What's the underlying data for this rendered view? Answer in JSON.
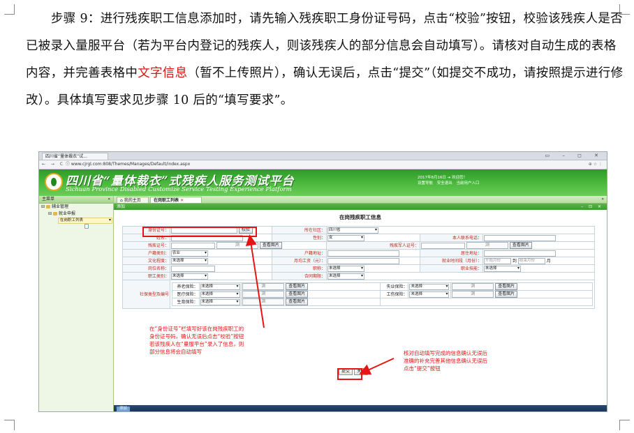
{
  "doc": {
    "p1_a": "步骤 9：进行残疾职工信息添加时，请先输入残疾职工身份证号码，点击“校验”按钮，校验该残疾人是否已被录入量服平台（若为平台内登记的残疾人，则该残疾人的部分信息会自动填写）。请核对自动生成的表格内容，并完善表格中",
    "p1_red": "文字信息",
    "p1_b": "（暂不上传照片），确认无误后，点击“提交”（如提交不成功，请按照提示进行修改）。具体填写要求见步骤 10 后的“填写要求”。"
  },
  "browser": {
    "tab_title": "四川省“量体裁衣”试...",
    "window_controls": "▭ – ◻ ✕",
    "nav": "← → C",
    "url": "ⓘ www.cjrgl.com:808/Themes/Manages/Default/index.aspx",
    "right_icons": "⊕ ☆ ⋮"
  },
  "banner": {
    "title_cn": "四川省“量体裁衣”式残疾人服务测试平台",
    "title_en": "Sichuan Province Disabled Customize Service Testing Experience Platform",
    "date": "2017年8月16日",
    "welcome": "欢迎您！",
    "links": [
      "设置导航",
      "安全退出",
      "当前用户入口"
    ]
  },
  "sidebar": {
    "header": "主菜单",
    "collapse": "«",
    "items": [
      "辅业管理",
      "就业申报",
      "在岗职工列表"
    ]
  },
  "content_tabs": [
    {
      "label": "我的主页"
    },
    {
      "label": "在岗职工列表"
    }
  ],
  "tab_close": "✕",
  "tab_more": "»",
  "panel": {
    "title": "添加",
    "controls": "– ⊡ ✕"
  },
  "form": {
    "title": "在岗残疾职工信息",
    "id_label": "身份证号：",
    "verify_button": "校验",
    "community_label": "所在社区：",
    "community_value": "四川省",
    "name_label": "姓名：",
    "gender_label": "性别：",
    "gender_value": "女",
    "phone_label": "本人联系电话：",
    "disability_cert_label": "残疾证号：",
    "view_image": "查看图片",
    "guardian_cert_label": "残疾军人证号：",
    "household_type_label": "户籍类别：",
    "household_type_value": "农业",
    "household_addr_label": "户籍地址：",
    "residence_label": "居住地址：",
    "education_label": "文化程度：",
    "unselected": "未选择",
    "monthly_wage_label": "月均工资（元）：",
    "employment_time_label": "就业时间段（月份）：",
    "start_month": "开始月份",
    "to": "到",
    "end_month": "结束月份",
    "month": "月",
    "position_label": "岗位名称：",
    "title_label": "职称：",
    "vocation_label": "职业技能：",
    "job_category_label": "职工类别：",
    "contract_label": "合同期限：",
    "insurance_label": "社保类型及编号",
    "pension": "养老保险：",
    "unemployment": "失业保险：",
    "medical": "医疗保险：",
    "injury": "工伤保险：",
    "maternity": "生育保险：",
    "submit_button": "提交",
    "close_button": "关闭",
    "upload_glyph": "浏"
  },
  "annotations": {
    "left": [
      "在“身份证号”栏填写好该在岗残疾职工的",
      "身份证号码，确认无误后点击“校验”按钮",
      "若该残疾人在“量服平台”录入了信息，则",
      "部分信息将会自动填写"
    ],
    "right": [
      "核对自动填写完成的信息确认无误后",
      "准确的补充完善其他信息确认无误后",
      "点击“提交”按钮"
    ]
  },
  "taskbar": {
    "item": "添加"
  }
}
